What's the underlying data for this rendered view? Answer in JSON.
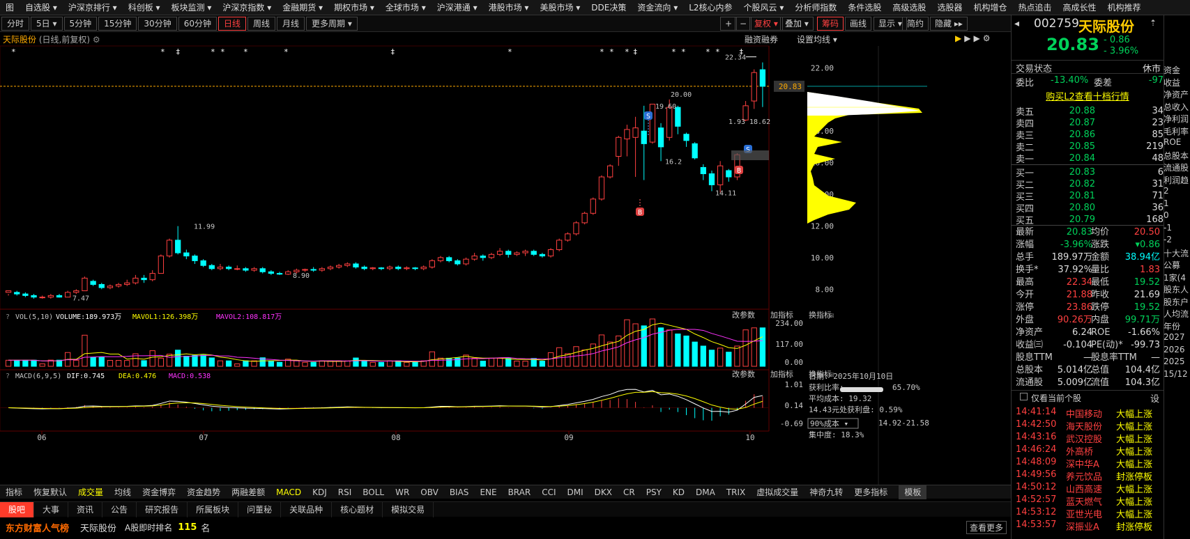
{
  "menu": [
    "图",
    "自选股 ▾",
    "沪深京排行 ▾",
    "科创板 ▾",
    "板块监测 ▾",
    "沪深京指数 ▾",
    "金融期货 ▾",
    "期权市场 ▾",
    "全球市场 ▾",
    "沪深港通 ▾",
    "港股市场 ▾",
    "美股市场 ▾",
    "DDE决策",
    "资金流向 ▾",
    "L2核心内参",
    "个股风云 ▾",
    "分析师指数",
    "条件选股",
    "高级选股",
    "选股器",
    "机构增仓",
    "热点追击",
    "高成长性",
    "机构推荐"
  ],
  "periods": [
    "分时",
    "5日 ▾",
    "5分钟",
    "15分钟",
    "30分钟",
    "60分钟",
    "日线",
    "周线",
    "月线",
    "更多周期 ▾"
  ],
  "period_active": "日线",
  "toolbar_right": [
    "+",
    "−",
    "复权 ▾",
    "叠加 ▾",
    "筹码",
    "画线",
    "显示 ▾",
    "简约",
    "隐藏 ▸▸"
  ],
  "chart_header": {
    "name": "天际股份",
    "sub": "(日线,前复权)",
    "btn1": "融资融券",
    "btn2": "设置均线 ▾"
  },
  "price_axis": [
    "22.00",
    "20.00",
    "18.00",
    "16.00",
    "14.00",
    "12.00",
    "10.00",
    "8.00"
  ],
  "current_price_tag": "20.83",
  "annotations": [
    "22.34",
    "20.00",
    "19.60",
    "16.2",
    "14.11",
    "11.99",
    "8.90",
    "7.47",
    "18.62",
    "1.93",
    "S",
    "S",
    "B",
    "B"
  ],
  "vol_legend": {
    "name": "VOL(5,10)",
    "v": "VOLUME:189.973万",
    "m1": "MAVOL1:126.398万",
    "m2": "MAVOL2:108.817万"
  },
  "vol_axis": [
    "234.00",
    "117.00",
    "0.00"
  ],
  "macd_legend": {
    "name": "MACD(6,9,5)",
    "dif": "DIF:0.745",
    "dea": "DEA:0.476",
    "macd": "MACD:0.538"
  },
  "macd_axis": [
    "1.01",
    "0.14",
    "-0.69"
  ],
  "sub_buttons": [
    "改参数",
    "加指标",
    "换指标"
  ],
  "x_axis": [
    "06",
    "07",
    "08",
    "09",
    "10"
  ],
  "chip": {
    "date": "日期: 2025年10月10日",
    "profit_label": "获利比率:",
    "profit": "65.70%",
    "avgcost": "平均成本: 19.32",
    "profit_at": "14.43元处获利盘: 0.59%",
    "cost_sel": "90%成本 ▾",
    "cost_range": "14.92-21.58",
    "conc": "集中度: 18.3%"
  },
  "stock": {
    "code": "002759",
    "name": "天际股份",
    "price": "20.83",
    "chg": "- 0.86",
    "pct": "- 3.96%"
  },
  "trade_status": {
    "label": "交易状态",
    "value": "休市"
  },
  "weibi": {
    "l1": "委比",
    "v1": "-13.40%",
    "l2": "委差",
    "v2": "-97"
  },
  "l2_link": "购买L2查看十档行情",
  "asks": [
    {
      "l": "卖五",
      "p": "20.88",
      "v": "34"
    },
    {
      "l": "卖四",
      "p": "20.87",
      "v": "23"
    },
    {
      "l": "卖三",
      "p": "20.86",
      "v": "85"
    },
    {
      "l": "卖二",
      "p": "20.85",
      "v": "219"
    },
    {
      "l": "卖一",
      "p": "20.84",
      "v": "48"
    }
  ],
  "bids": [
    {
      "l": "买一",
      "p": "20.83",
      "v": "6"
    },
    {
      "l": "买二",
      "p": "20.82",
      "v": "31"
    },
    {
      "l": "买三",
      "p": "20.81",
      "v": "71"
    },
    {
      "l": "买四",
      "p": "20.80",
      "v": "36"
    },
    {
      "l": "买五",
      "p": "20.79",
      "v": "168"
    }
  ],
  "stats": [
    {
      "l1": "最新",
      "v1": "20.83",
      "l2": "均价",
      "v2": "20.50"
    },
    {
      "l1": "涨幅",
      "v1": "-3.96%",
      "l2": "涨跌",
      "v2": "▾0.86"
    },
    {
      "l1": "总手",
      "v1": "189.97万",
      "l2": "金额",
      "v2": "38.94亿"
    },
    {
      "l1": "换手*",
      "v1": "37.92%",
      "l2": "量比",
      "v2": "1.83"
    },
    {
      "l1": "最高",
      "v1": "22.34",
      "l2": "最低",
      "v2": "19.52"
    },
    {
      "l1": "今开",
      "v1": "21.88",
      "l2": "昨收",
      "v2": "21.69"
    },
    {
      "l1": "涨停",
      "v1": "23.86",
      "l2": "跌停",
      "v2": "19.52"
    },
    {
      "l1": "外盘",
      "v1": "90.26万",
      "l2": "内盘",
      "v2": "99.71万"
    },
    {
      "l1": "净资产",
      "v1": "6.24",
      "l2": "ROE",
      "v2": "-1.66%"
    },
    {
      "l1": "收益㈢",
      "v1": "-0.104",
      "l2": "PE(动)*",
      "v2": "-99.73"
    },
    {
      "l1": "股息TTM",
      "v1": "—",
      "l2": "股息率TTM",
      "v2": "—"
    },
    {
      "l1": "总股本",
      "v1": "5.014亿",
      "l2": "总值",
      "v2": "104.4亿"
    },
    {
      "l1": "流通股",
      "v1": "5.009亿",
      "l2": "流值",
      "v2": "104.3亿"
    }
  ],
  "only_current": "仅看当前个股",
  "news_btn": "设",
  "news": [
    {
      "t": "14:41:14",
      "n": "中国移动",
      "s": "大幅上涨"
    },
    {
      "t": "14:42:50",
      "n": "海天股份",
      "s": "大幅上涨"
    },
    {
      "t": "14:43:16",
      "n": "武汉控股",
      "s": "大幅上涨"
    },
    {
      "t": "14:46:24",
      "n": "外高桥",
      "s": "大幅上涨"
    },
    {
      "t": "14:48:09",
      "n": "深中华A",
      "s": "大幅上涨"
    },
    {
      "t": "14:49:56",
      "n": "养元饮品",
      "s": "封涨停板"
    },
    {
      "t": "14:50:12",
      "n": "山西高速",
      "s": "大幅上涨"
    },
    {
      "t": "14:52:57",
      "n": "蓝天燃气",
      "s": "大幅上涨"
    },
    {
      "t": "14:53:12",
      "n": "亚世光电",
      "s": "大幅上涨"
    },
    {
      "t": "14:53:57",
      "n": "深振业A",
      "s": "封涨停板"
    }
  ],
  "side_clip": [
    "资金",
    "收益",
    "净资产",
    "总收入",
    "净利润",
    "毛利率",
    "ROE",
    "总股本",
    "流通股",
    "利润趋",
    "2",
    "1",
    "0",
    "-1",
    "-2",
    "十大流",
    "公募",
    "1家(4",
    "股东人",
    "股东户",
    "人均流",
    "年份",
    "2027",
    "2026",
    "2025",
    "15/12"
  ],
  "indicators": [
    "指标",
    "恢复默认",
    "成交量",
    "均线",
    "资金博弈",
    "资金趋势",
    "两融差额",
    "MACD",
    "KDJ",
    "RSI",
    "BOLL",
    "WR",
    "OBV",
    "BIAS",
    "ENE",
    "BRAR",
    "CCI",
    "DMI",
    "DKX",
    "CR",
    "PSY",
    "KD",
    "DMA",
    "TRIX",
    "虚拟成交量",
    "神奇九转",
    "更多指标",
    "模板"
  ],
  "info_tabs": [
    "股吧",
    "大事",
    "资讯",
    "公告",
    "研究报告",
    "所属板块",
    "问董秘",
    "关联品种",
    "核心题材",
    "模拟交易"
  ],
  "pop": {
    "brand": "东方财富人气榜",
    "name": "天际股份",
    "label": "A股即时排名",
    "rank": "115",
    "unit": "名",
    "more": "查看更多"
  },
  "colors": {
    "up": "#ff4040",
    "down": "#00ffff",
    "ma": "#ffff00"
  },
  "chart_data": {
    "type": "candlestick",
    "x": [
      "06",
      "07",
      "08",
      "09",
      "10"
    ],
    "ylim": [
      7,
      22.5
    ],
    "candles": [
      [
        7.8,
        7.9,
        7.7,
        7.6
      ],
      [
        7.8,
        7.7,
        7.9,
        7.6
      ],
      [
        7.7,
        7.6,
        7.8,
        7.5
      ],
      [
        7.6,
        7.5,
        7.7,
        7.4
      ],
      [
        7.5,
        7.5,
        7.6,
        7.4
      ],
      [
        7.5,
        7.6,
        7.7,
        7.4
      ],
      [
        7.6,
        7.5,
        7.7,
        7.47
      ],
      [
        7.5,
        7.8,
        7.9,
        7.5
      ],
      [
        7.8,
        7.9,
        8.0,
        7.7
      ],
      [
        7.9,
        8.7,
        8.8,
        7.9
      ],
      [
        8.5,
        8.3,
        8.6,
        8.2
      ],
      [
        8.3,
        8.1,
        8.4,
        8.0
      ],
      [
        8.1,
        8.2,
        8.3,
        8.0
      ],
      [
        8.2,
        8.3,
        8.4,
        8.1
      ],
      [
        8.3,
        8.4,
        8.6,
        8.2
      ],
      [
        8.4,
        8.7,
        8.9,
        8.3
      ],
      [
        8.7,
        8.6,
        8.9,
        8.4
      ],
      [
        8.6,
        9.0,
        9.2,
        8.5
      ],
      [
        9.0,
        10.1,
        10.2,
        9.0
      ],
      [
        10.1,
        11.1,
        11.2,
        10.0
      ],
      [
        11.1,
        10.3,
        11.99,
        10.2
      ],
      [
        10.3,
        10.1,
        10.5,
        9.9
      ],
      [
        10.1,
        9.8,
        10.2,
        9.6
      ],
      [
        9.8,
        9.5,
        9.9,
        9.4
      ],
      [
        9.5,
        9.3,
        9.6,
        9.2
      ],
      [
        9.3,
        9.4,
        9.6,
        9.2
      ],
      [
        9.4,
        9.3,
        9.5,
        9.2
      ],
      [
        9.3,
        9.3,
        9.5,
        9.2
      ],
      [
        9.3,
        9.2,
        9.4,
        9.1
      ],
      [
        9.2,
        9.3,
        9.4,
        9.1
      ],
      [
        9.3,
        9.1,
        9.4,
        9.0
      ],
      [
        9.1,
        9.0,
        9.2,
        8.9
      ],
      [
        9.0,
        8.95,
        9.1,
        8.9
      ],
      [
        8.95,
        9.1,
        9.2,
        8.9
      ],
      [
        9.1,
        9.2,
        9.3,
        9.0
      ],
      [
        9.2,
        9.25,
        9.3,
        9.1
      ],
      [
        9.25,
        9.2,
        9.4,
        9.1
      ],
      [
        9.2,
        9.3,
        9.4,
        9.1
      ],
      [
        9.3,
        9.4,
        9.5,
        9.2
      ],
      [
        9.4,
        9.5,
        9.6,
        9.3
      ],
      [
        9.5,
        9.6,
        9.7,
        9.4
      ],
      [
        9.6,
        9.4,
        9.7,
        9.3
      ],
      [
        9.4,
        9.3,
        9.5,
        9.2
      ],
      [
        9.3,
        9.35,
        9.4,
        9.2
      ],
      [
        9.35,
        9.3,
        9.4,
        9.2
      ],
      [
        9.3,
        9.4,
        9.5,
        9.2
      ],
      [
        9.4,
        9.3,
        9.5,
        9.2
      ],
      [
        9.3,
        9.35,
        9.45,
        9.2
      ],
      [
        9.35,
        9.3,
        9.4,
        9.2
      ],
      [
        9.3,
        9.4,
        9.5,
        9.2
      ],
      [
        9.4,
        9.8,
        9.9,
        9.3
      ],
      [
        9.8,
        10.0,
        10.1,
        9.7
      ],
      [
        10.0,
        9.8,
        10.1,
        9.7
      ],
      [
        9.8,
        9.6,
        9.9,
        9.5
      ],
      [
        9.6,
        9.9,
        10.0,
        9.5
      ],
      [
        9.9,
        10.1,
        10.3,
        9.8
      ],
      [
        10.1,
        10.0,
        10.2,
        9.8
      ],
      [
        10.0,
        10.2,
        10.3,
        9.9
      ],
      [
        10.2,
        10.4,
        10.6,
        10.1
      ],
      [
        10.4,
        10.2,
        10.5,
        10.0
      ],
      [
        10.2,
        10.3,
        10.4,
        10.1
      ],
      [
        10.3,
        10.4,
        10.5,
        10.1
      ],
      [
        10.4,
        10.2,
        10.5,
        10.1
      ],
      [
        10.2,
        10.1,
        10.3,
        10.0
      ],
      [
        10.1,
        10.5,
        10.6,
        10.0
      ],
      [
        10.5,
        11.1,
        11.2,
        10.4
      ],
      [
        11.1,
        11.5,
        11.6,
        11.0
      ],
      [
        11.5,
        12.2,
        12.3,
        11.4
      ],
      [
        12.2,
        12.8,
        12.9,
        12.1
      ],
      [
        12.8,
        13.7,
        13.8,
        12.7
      ],
      [
        13.7,
        15.1,
        15.2,
        13.6
      ],
      [
        15.1,
        15.8,
        15.9,
        15.0
      ],
      [
        16.4,
        17.6,
        17.7,
        15.8
      ],
      [
        17.5,
        18.1,
        18.4,
        16.4
      ],
      [
        17.6,
        18.2,
        18.9,
        15.1
      ],
      [
        18.0,
        17.2,
        19.6,
        14.9
      ],
      [
        17.3,
        19.7,
        19.7,
        17.2
      ],
      [
        18.2,
        17.0,
        18.5,
        16.1
      ],
      [
        17.6,
        19.5,
        20.0,
        17.4
      ],
      [
        19.5,
        18.3,
        19.6,
        17.8
      ],
      [
        17.8,
        17.4,
        17.9,
        17.0
      ],
      [
        17.2,
        16.3,
        17.3,
        16.2
      ],
      [
        15.7,
        15.3,
        15.9,
        14.9
      ],
      [
        15.3,
        14.6,
        15.5,
        14.2
      ],
      [
        14.6,
        15.8,
        16.1,
        14.11
      ],
      [
        15.5,
        15.1,
        15.6,
        14.8
      ],
      [
        15.1,
        16.5,
        16.6,
        14.9
      ],
      [
        18.7,
        19.6,
        19.9,
        18.62
      ],
      [
        19.9,
        21.7,
        21.9,
        19.4
      ],
      [
        21.88,
        20.83,
        22.34,
        19.52
      ]
    ],
    "volume_ylim": [
      0,
      234
    ],
    "macd_ylim": [
      -0.69,
      1.01
    ]
  }
}
